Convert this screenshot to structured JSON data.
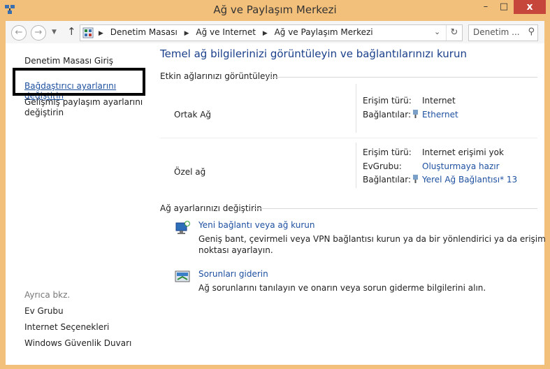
{
  "window": {
    "title": "Ağ ve Paylaşım Merkezi",
    "controls": {
      "minimize": "–",
      "maximize": "□",
      "close": "x"
    }
  },
  "navbar": {
    "back": "←",
    "forward": "→",
    "up": "↑",
    "breadcrumb": [
      "Denetim Masası",
      "Ağ ve Internet",
      "Ağ ve Paylaşım Merkezi"
    ],
    "search_placeholder": "Denetim ..."
  },
  "sidebar": {
    "items": [
      {
        "label": "Denetim Masası Giriş"
      },
      {
        "label": "Bağdaştırıcı ayarlarını değiştirin"
      },
      {
        "label": "Gelişmiş paylaşım ayarlarını değiştirin"
      }
    ],
    "see_also_label": "Ayrıca bkz.",
    "see_also": [
      {
        "label": "Ev Grubu"
      },
      {
        "label": "Internet Seçenekleri"
      },
      {
        "label": "Windows Güvenlik Duvarı"
      }
    ]
  },
  "main": {
    "title": "Temel ağ bilgilerinizi görüntüleyin ve bağlantılarınızı kurun",
    "active_networks_header": "Etkin ağlarınızı görüntüleyin",
    "networks": [
      {
        "name": "Ortak Ağ",
        "access_type_label": "Erişim türü:",
        "access_type": "Internet",
        "connections_label": "Bağlantılar:",
        "connection": "Ethernet"
      },
      {
        "name": "Özel ağ",
        "access_type_label": "Erişim türü:",
        "access_type": "Internet erişimi yok",
        "homegroup_label": "EvGrubu:",
        "homegroup": "Oluşturmaya hazır",
        "connections_label": "Bağlantılar:",
        "connection": "Yerel Ağ Bağlantısı* 13"
      }
    ],
    "change_settings_header": "Ağ ayarlarınızı değiştirin",
    "tasks": [
      {
        "title": "Yeni bağlantı veya ağ kurun",
        "description": "Geniş bant, çevirmeli veya VPN bağlantısı kurun ya da bir yönlendirici ya da erişim noktası ayarlayın."
      },
      {
        "title": "Sorunları giderin",
        "description": "Ağ sorunlarını tanılayın ve onarın veya sorun giderme bilgilerini alın."
      }
    ]
  }
}
